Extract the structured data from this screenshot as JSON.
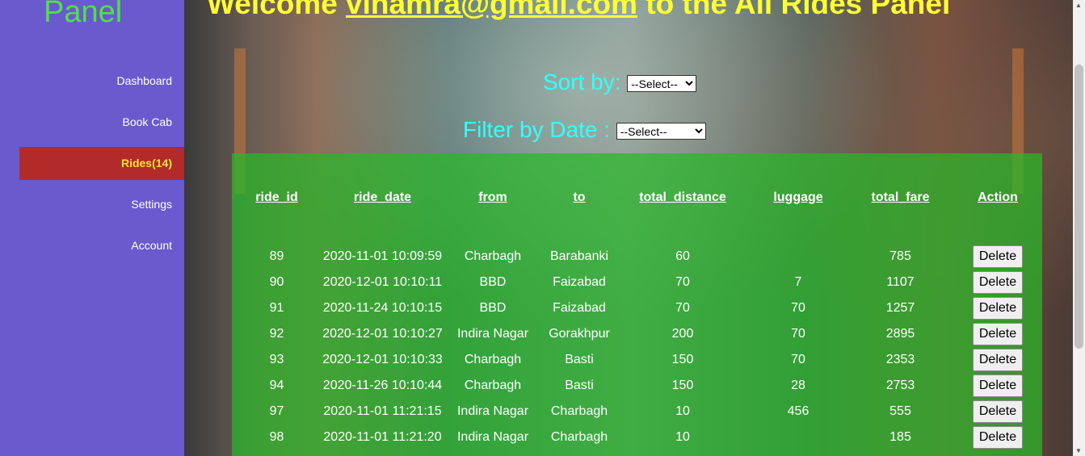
{
  "sidebar": {
    "title": "Panel",
    "items": [
      {
        "label": "Dashboard"
      },
      {
        "label": "Book Cab"
      },
      {
        "label": "Rides(14)"
      },
      {
        "label": "Settings"
      },
      {
        "label": "Account"
      }
    ]
  },
  "header": {
    "welcome_prefix": "Welcome ",
    "email": "vinamra@gmail.com",
    "welcome_suffix": " to the All Rides Panel"
  },
  "sort": {
    "label": "Sort by: ",
    "selected": "--Select--"
  },
  "filter": {
    "label": "Filter by Date : ",
    "selected": "--Select--"
  },
  "table": {
    "columns": [
      "ride_id",
      "ride_date",
      "from",
      "to",
      "total_distance",
      "luggage",
      "total_fare",
      "Action"
    ],
    "delete_label": "Delete",
    "rows": [
      {
        "ride_id": "89",
        "ride_date": "2020-11-01 10:09:59",
        "from": "Charbagh",
        "to": "Barabanki",
        "total_distance": "60",
        "luggage": "",
        "total_fare": "785"
      },
      {
        "ride_id": "90",
        "ride_date": "2020-12-01 10:10:11",
        "from": "BBD",
        "to": "Faizabad",
        "total_distance": "70",
        "luggage": "7",
        "total_fare": "1107"
      },
      {
        "ride_id": "91",
        "ride_date": "2020-11-24 10:10:15",
        "from": "BBD",
        "to": "Faizabad",
        "total_distance": "70",
        "luggage": "70",
        "total_fare": "1257"
      },
      {
        "ride_id": "92",
        "ride_date": "2020-12-01 10:10:27",
        "from": "Indira Nagar",
        "to": "Gorakhpur",
        "total_distance": "200",
        "luggage": "70",
        "total_fare": "2895"
      },
      {
        "ride_id": "93",
        "ride_date": "2020-12-01 10:10:33",
        "from": "Charbagh",
        "to": "Basti",
        "total_distance": "150",
        "luggage": "70",
        "total_fare": "2353"
      },
      {
        "ride_id": "94",
        "ride_date": "2020-11-26 10:10:44",
        "from": "Charbagh",
        "to": "Basti",
        "total_distance": "150",
        "luggage": "28",
        "total_fare": "2753"
      },
      {
        "ride_id": "97",
        "ride_date": "2020-11-01 11:21:15",
        "from": "Indira Nagar",
        "to": "Charbagh",
        "total_distance": "10",
        "luggage": "456",
        "total_fare": "555"
      },
      {
        "ride_id": "98",
        "ride_date": "2020-11-01 11:21:20",
        "from": "Indira Nagar",
        "to": "Charbagh",
        "total_distance": "10",
        "luggage": "",
        "total_fare": "185"
      }
    ]
  },
  "colors": {
    "sidebar_bg": "#6a5acd",
    "active_nav_bg": "#b22a2a",
    "active_nav_text": "#ffe135",
    "welcome_text": "#ffff33",
    "controls_text": "#33ffff",
    "panel_bg": "#28b928"
  }
}
